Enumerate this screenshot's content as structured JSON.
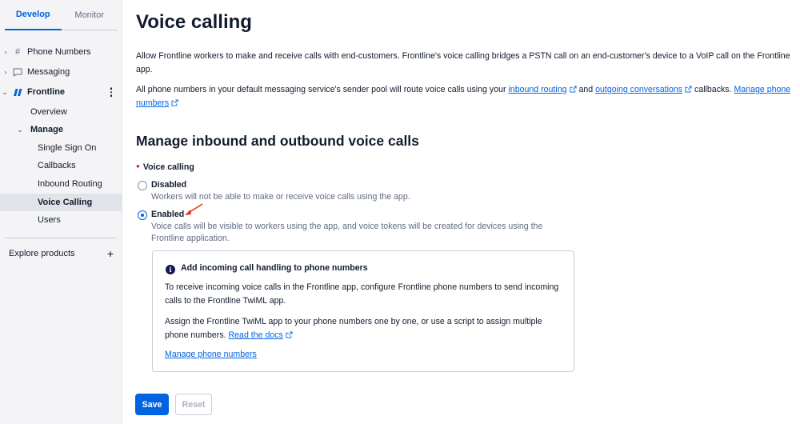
{
  "sidebar": {
    "tabs": [
      {
        "label": "Develop",
        "active": true
      },
      {
        "label": "Monitor",
        "active": false
      }
    ],
    "nav": {
      "phone_numbers": "Phone Numbers",
      "messaging": "Messaging",
      "frontline": "Frontline",
      "overview": "Overview",
      "manage": "Manage",
      "single_sign_on": "Single Sign On",
      "callbacks": "Callbacks",
      "inbound_routing": "Inbound Routing",
      "voice_calling": "Voice Calling",
      "users": "Users"
    },
    "explore_products": "Explore products"
  },
  "page": {
    "title": "Voice calling",
    "intro": "Allow Frontline workers to make and receive calls with end-customers. Frontline's voice calling bridges a PSTN call on an end-customer's device to a VoIP call on the Frontline app.",
    "routing_prefix": "All phone numbers in your default messaging service's sender pool will route voice calls using your",
    "inbound_routing_link": "inbound routing",
    "and": "and",
    "outgoing_link": "outgoing conversations",
    "callbacks_text": "callbacks.",
    "manage_phone_link": "Manage phone numbers",
    "section_title": "Manage inbound and outbound voice calls",
    "field_label": "Voice calling",
    "options": [
      {
        "label": "Disabled",
        "help": "Workers will not be able to make or receive voice calls using the app.",
        "checked": false
      },
      {
        "label": "Enabled",
        "help": "Voice calls will be visible to workers using the app, and voice tokens will be created for devices using the Frontline application.",
        "checked": true
      }
    ],
    "info": {
      "title": "Add incoming call handling to phone numbers",
      "para1": "To receive incoming voice calls in the Frontline app, configure Frontline phone numbers to send incoming calls to the Frontline TwiML app.",
      "para2": "Assign the Frontline TwiML app to your phone numbers one by one, or use a script to assign multiple phone numbers.",
      "docs_link": "Read the docs",
      "manage_link": "Manage phone numbers"
    },
    "save_label": "Save",
    "reset_label": "Reset"
  },
  "colors": {
    "accent": "#0263e0",
    "annotation_arrow": "#e8301c",
    "required": "#d61f1f"
  },
  "icons": [
    "hash-icon",
    "chat-icon",
    "frontline-logo-icon",
    "external-link-icon",
    "info-icon",
    "plus-icon"
  ]
}
